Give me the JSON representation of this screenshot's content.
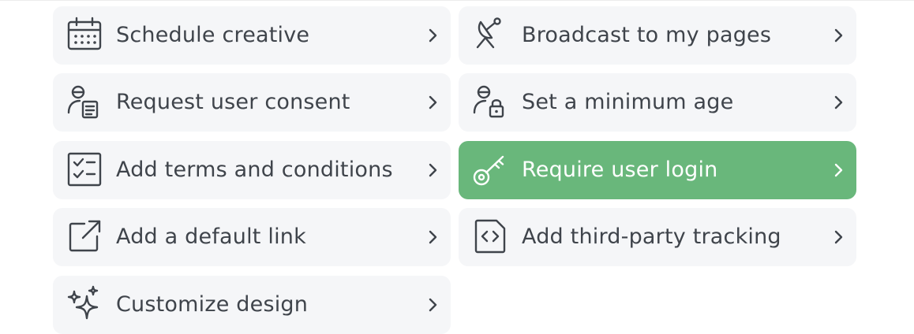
{
  "options": [
    {
      "label": "Schedule creative",
      "icon": "calendar-icon"
    },
    {
      "label": "Broadcast to my pages",
      "icon": "satellite-dish-icon"
    },
    {
      "label": "Request user consent",
      "icon": "user-document-icon"
    },
    {
      "label": "Set a minimum age",
      "icon": "user-lock-icon"
    },
    {
      "label": "Add terms and conditions",
      "icon": "checklist-icon"
    },
    {
      "label": "Require user login",
      "icon": "key-icon",
      "selected": true
    },
    {
      "label": "Add a default link",
      "icon": "external-link-icon"
    },
    {
      "label": "Add third-party tracking",
      "icon": "code-file-icon"
    },
    {
      "label": "Customize design",
      "icon": "sparkles-icon"
    }
  ],
  "colors": {
    "card_background": "#f5f6f8",
    "selected_background": "#69b77b",
    "text": "#3f444b",
    "selected_text": "#ffffff"
  }
}
